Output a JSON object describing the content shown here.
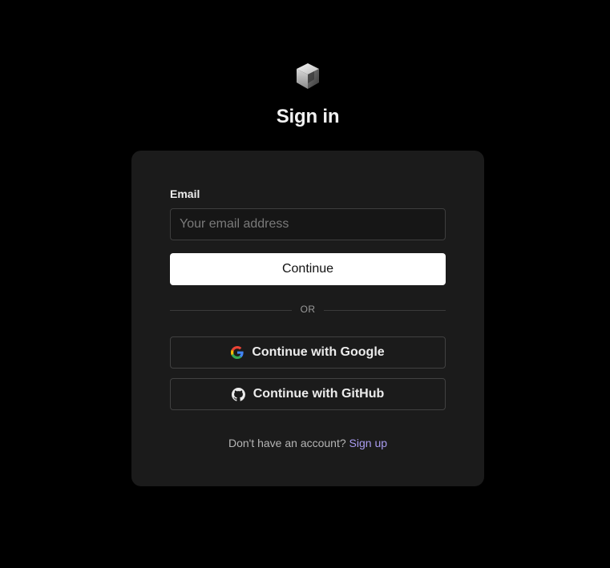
{
  "header": {
    "logo_icon": "cube-logo-icon",
    "title": "Sign in"
  },
  "form": {
    "email_label": "Email",
    "email_value": "",
    "email_placeholder": "Your email address",
    "continue_label": "Continue",
    "divider_text": "OR",
    "google_label": "Continue with Google",
    "google_icon": "google-icon",
    "github_label": "Continue with GitHub",
    "github_icon": "github-icon"
  },
  "footer": {
    "prompt": "Don't have an account?",
    "signup_label": "Sign up"
  },
  "colors": {
    "background": "#000000",
    "card": "#1b1b1b",
    "primary_button": "#ffffff",
    "link": "#a99cf0"
  }
}
